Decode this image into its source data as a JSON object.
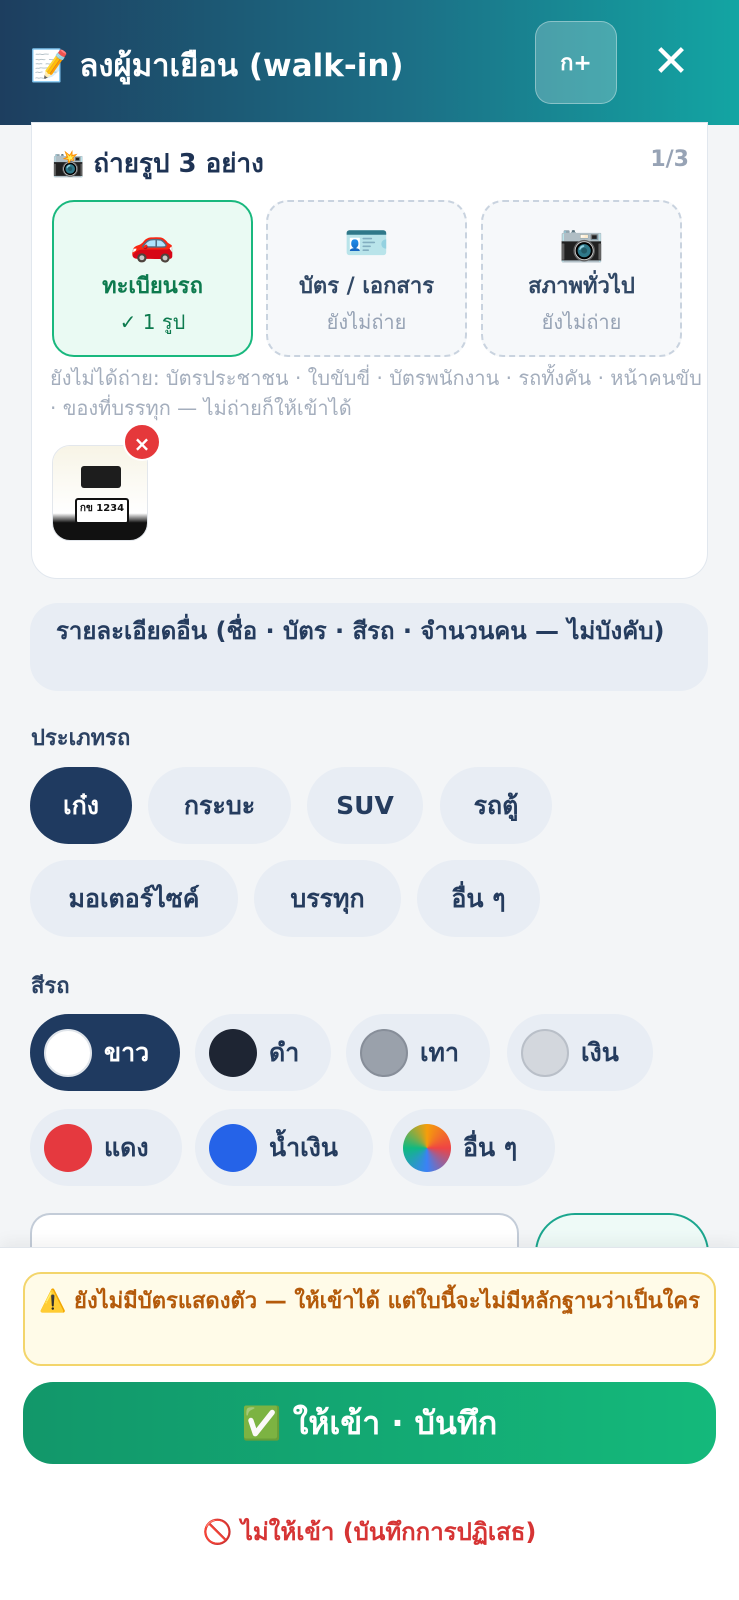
{
  "header": {
    "icon": "memo-icon",
    "title": "📝 ลงผู้มาเยือน (walk-in)",
    "lang_button": "ก+",
    "close": "✕"
  },
  "photo_section": {
    "title": "📸 ถ่ายรูป 3 อย่าง",
    "count": "1/3",
    "tiles": [
      {
        "icon": "🚗",
        "label": "ทะเบียนรถ",
        "status": "✓ 1 รูป",
        "state": "done"
      },
      {
        "icon": "🪪",
        "label": "บัตร / เอกสาร",
        "status": "ยังไม่ถ่าย",
        "state": "pending"
      },
      {
        "icon": "📷",
        "label": "สภาพทั่วไป",
        "status": "ยังไม่ถ่าย",
        "state": "pending"
      }
    ],
    "hint": "ยังไม่ได้ถ่าย: บัตรประชาชน · ใบขับขี่ · บัตรพนักงาน · รถทั้งคัน · หน้าคนขับ · ของที่บรรทุก — ไม่ถ่ายก็ให้เข้าได้",
    "thumbnail_plate": "กข 1234",
    "remove": "×"
  },
  "details_toggle": "รายละเอียดอื่น (ชื่อ · บัตร · สีรถ · จำนวนคน — ไม่บังคับ)",
  "vehicle_type": {
    "label": "ประเภทรถ",
    "options": [
      "เก๋ง",
      "กระบะ",
      "SUV",
      "รถตู้",
      "มอเตอร์ไซค์",
      "บรรทุก",
      "อื่น ๆ"
    ],
    "selected": "เก๋ง"
  },
  "vehicle_color": {
    "label": "สีรถ",
    "options": [
      {
        "label": "ขาว",
        "color": "#ffffff"
      },
      {
        "label": "ดำ",
        "color": "#1e2533"
      },
      {
        "label": "เทา",
        "color": "#9aa1ab"
      },
      {
        "label": "เงิน",
        "color": "#d3d7dd"
      },
      {
        "label": "แดง",
        "color": "#e5393f"
      },
      {
        "label": "น้ำเงิน",
        "color": "#2563e8"
      },
      {
        "label": "อื่น ๆ",
        "color": "gradient"
      }
    ],
    "selected": "ขาว"
  },
  "footer": {
    "warning": "⚠️ ยังไม่มีบัตรแสดงตัว — ให้เข้าได้ แต่ใบนี้จะไม่มีหลักฐานว่าเป็นใคร",
    "allow_button": "✅ ให้เข้า · บันทึก",
    "deny_button": "🚫 ไม่ให้เข้า (บันทึกการปฏิเสธ)"
  },
  "colors": {
    "header_gradient_start": "#1d3e5f",
    "header_gradient_end": "#13a5a3",
    "selected_chip": "#1f3a60",
    "allow_green": "#14b97b",
    "deny_red": "#d63434",
    "warning_text": "#b45a0a"
  }
}
